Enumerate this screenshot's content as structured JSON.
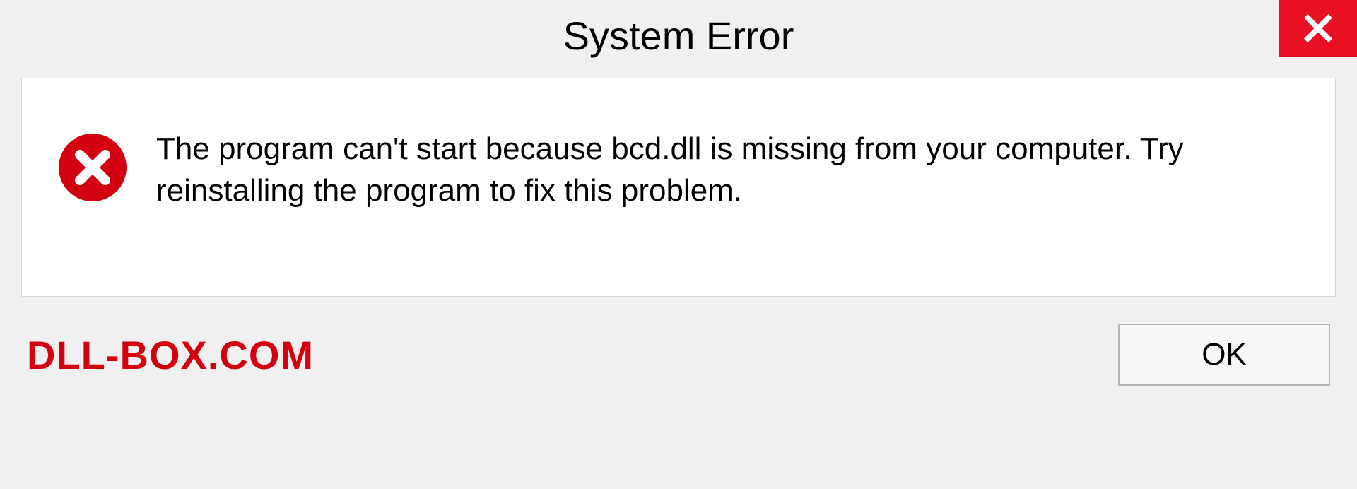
{
  "titlebar": {
    "title": "System Error"
  },
  "content": {
    "message": "The program can't start because bcd.dll is missing from your computer. Try reinstalling the program to fix this problem."
  },
  "footer": {
    "watermark": "DLL-BOX.COM",
    "ok_label": "OK"
  },
  "colors": {
    "close_bg": "#e81123",
    "error_icon": "#d3000f",
    "watermark": "#d3000f"
  }
}
